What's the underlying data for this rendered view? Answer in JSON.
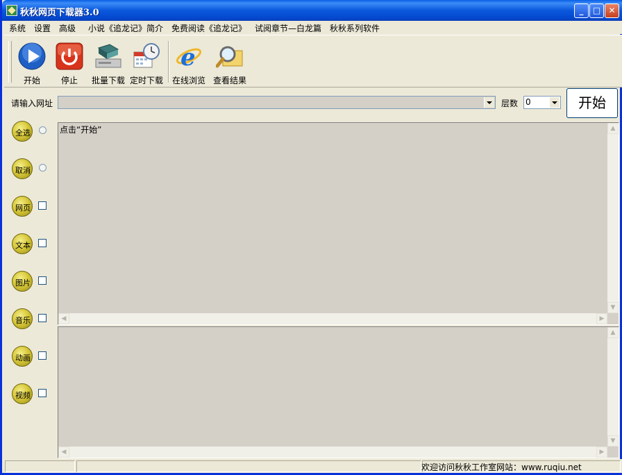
{
  "window": {
    "title": "秋秋网页下载器3.0",
    "controls": {
      "minimize": "_",
      "maximize": "□",
      "close": "✕"
    }
  },
  "menu": [
    "系统",
    "设置",
    "高级",
    "小说《追龙记》简介",
    "免费阅读《追龙记》",
    "试阅章节—白龙篇",
    "秋秋系列软件"
  ],
  "toolbar": {
    "start": "开始",
    "stop": "停止",
    "batch_download": "批量下载",
    "scheduled_download": "定时下载",
    "online_browse": "在线浏览",
    "view_results": "查看结果"
  },
  "url_bar": {
    "label": "请输入网址",
    "value": "",
    "layers_label": "层数",
    "layers_value": "0",
    "start_button": "开始"
  },
  "side_options": [
    {
      "label": "全选",
      "control": "radio"
    },
    {
      "label": "取消",
      "control": "radio"
    },
    {
      "label": "网页",
      "control": "checkbox"
    },
    {
      "label": "文本",
      "control": "checkbox"
    },
    {
      "label": "图片",
      "control": "checkbox"
    },
    {
      "label": "音乐",
      "control": "checkbox"
    },
    {
      "label": "动画",
      "control": "checkbox"
    },
    {
      "label": "视频",
      "control": "checkbox"
    }
  ],
  "output_pane": {
    "text": "点击“开始”"
  },
  "status_bar": {
    "message": "欢迎访问秋秋工作室网站：www.ruqiu.net"
  },
  "colors": {
    "titlebar": "#0b58dc",
    "face": "#ece9d8",
    "pane": "#d4d0c8",
    "coin": "#d8c93a"
  }
}
